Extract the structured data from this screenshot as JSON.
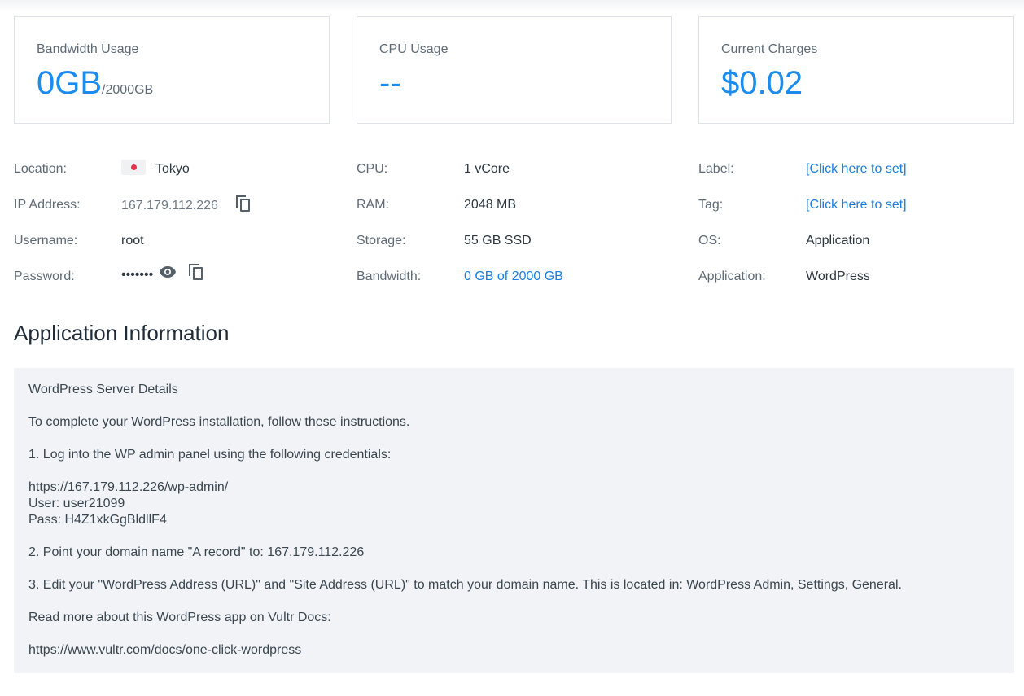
{
  "stats": {
    "bandwidth": {
      "title": "Bandwidth Usage",
      "value": "0GB",
      "sub": "/2000GB"
    },
    "cpu": {
      "title": "CPU Usage",
      "value": "--"
    },
    "charges": {
      "title": "Current Charges",
      "value": "$0.02"
    }
  },
  "details": {
    "location": {
      "label": "Location:",
      "value": "Tokyo"
    },
    "ip": {
      "label": "IP Address:",
      "value": "167.179.112.226"
    },
    "username": {
      "label": "Username:",
      "value": "root"
    },
    "password": {
      "label": "Password:",
      "value": "•••••••"
    },
    "cpu": {
      "label": "CPU:",
      "value": "1 vCore"
    },
    "ram": {
      "label": "RAM:",
      "value": "2048 MB"
    },
    "storage": {
      "label": "Storage:",
      "value": "55 GB SSD"
    },
    "bandwidth": {
      "label": "Bandwidth:",
      "value": "0 GB of 2000 GB"
    },
    "label": {
      "label": "Label:",
      "value": "[Click here to set]"
    },
    "tag": {
      "label": "Tag:",
      "value": "[Click here to set]"
    },
    "os": {
      "label": "OS:",
      "value": "Application"
    },
    "application": {
      "label": "Application:",
      "value": "WordPress"
    }
  },
  "app_info": {
    "title": "Application Information",
    "lines": [
      "WordPress Server Details",
      "To complete your WordPress installation, follow these instructions.",
      "1. Log into the WP admin panel using the following credentials:",
      "https://167.179.112.226/wp-admin/",
      "User: user21099",
      "Pass: H4Z1xkGgBldllF4",
      "2. Point your domain name \"A record\" to: 167.179.112.226",
      "3. Edit your \"WordPress Address (URL)\" and \"Site Address (URL)\" to match your domain name. This is located in: WordPress Admin, Settings, General.",
      "Read more about this WordPress app on Vultr Docs:",
      "https://www.vultr.com/docs/one-click-wordpress"
    ]
  },
  "icons": {
    "flag": "japan-flag-icon",
    "copy": "copy-icon",
    "eye": "eye-icon"
  },
  "colors": {
    "accent": "#1a8cf0",
    "link": "#1a7fe0",
    "panel_bg": "#f1f3f6"
  }
}
